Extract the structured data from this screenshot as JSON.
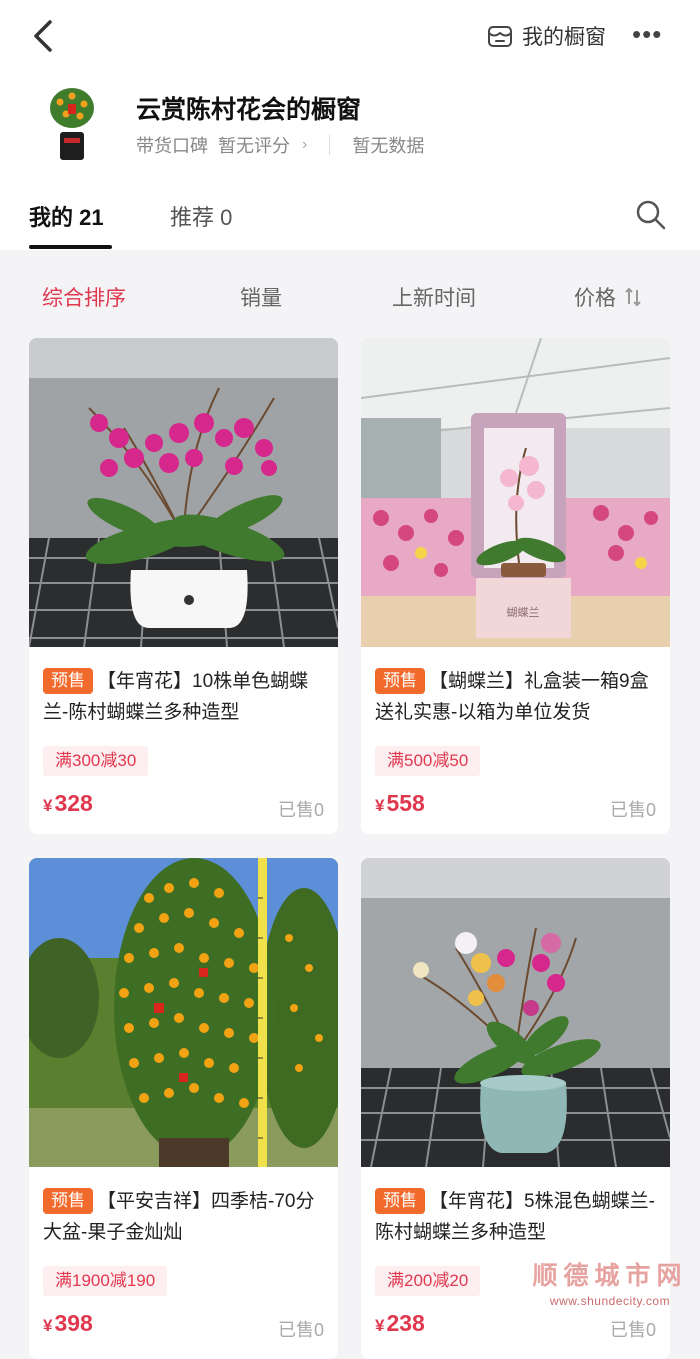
{
  "header": {
    "window_link_label": "我的橱窗",
    "more_label": "•••"
  },
  "shop": {
    "name": "云赏陈村花会的橱窗",
    "reputation_label": "带货口碑",
    "reputation_value": "暂无评分",
    "data_label": "暂无数据"
  },
  "tabs": [
    {
      "label": "我的 21"
    },
    {
      "label": "推荐 0"
    }
  ],
  "sort": {
    "options": [
      "综合排序",
      "销量",
      "上新时间",
      "价格"
    ]
  },
  "products": [
    {
      "badge": "预售",
      "title": "【年宵花】10株单色蝴蝶兰-陈村蝴蝶兰多种造型",
      "coupon": "满300减30",
      "currency": "¥",
      "price": "328",
      "sold": "已售0"
    },
    {
      "badge": "预售",
      "title": "【蝴蝶兰】礼盒装一箱9盒送礼实惠-以箱为单位发货",
      "coupon": "满500减50",
      "currency": "¥",
      "price": "558",
      "sold": "已售0",
      "box_label": "蝴蝶兰"
    },
    {
      "badge": "预售",
      "title": "【平安吉祥】四季桔-70分大盆-果子金灿灿",
      "coupon": "满1900减190",
      "currency": "¥",
      "price": "398",
      "sold": "已售0"
    },
    {
      "badge": "预售",
      "title": "【年宵花】5株混色蝴蝶兰-陈村蝴蝶兰多种造型",
      "coupon": "满200减20",
      "currency": "¥",
      "price": "238",
      "sold": "已售0"
    }
  ],
  "watermark": {
    "name": "顺德城市网",
    "url": "www.shundecity.com"
  },
  "colors": {
    "accent": "#e0384f",
    "presale": "#f26a2b",
    "coupon_bg": "#fdeef0"
  }
}
